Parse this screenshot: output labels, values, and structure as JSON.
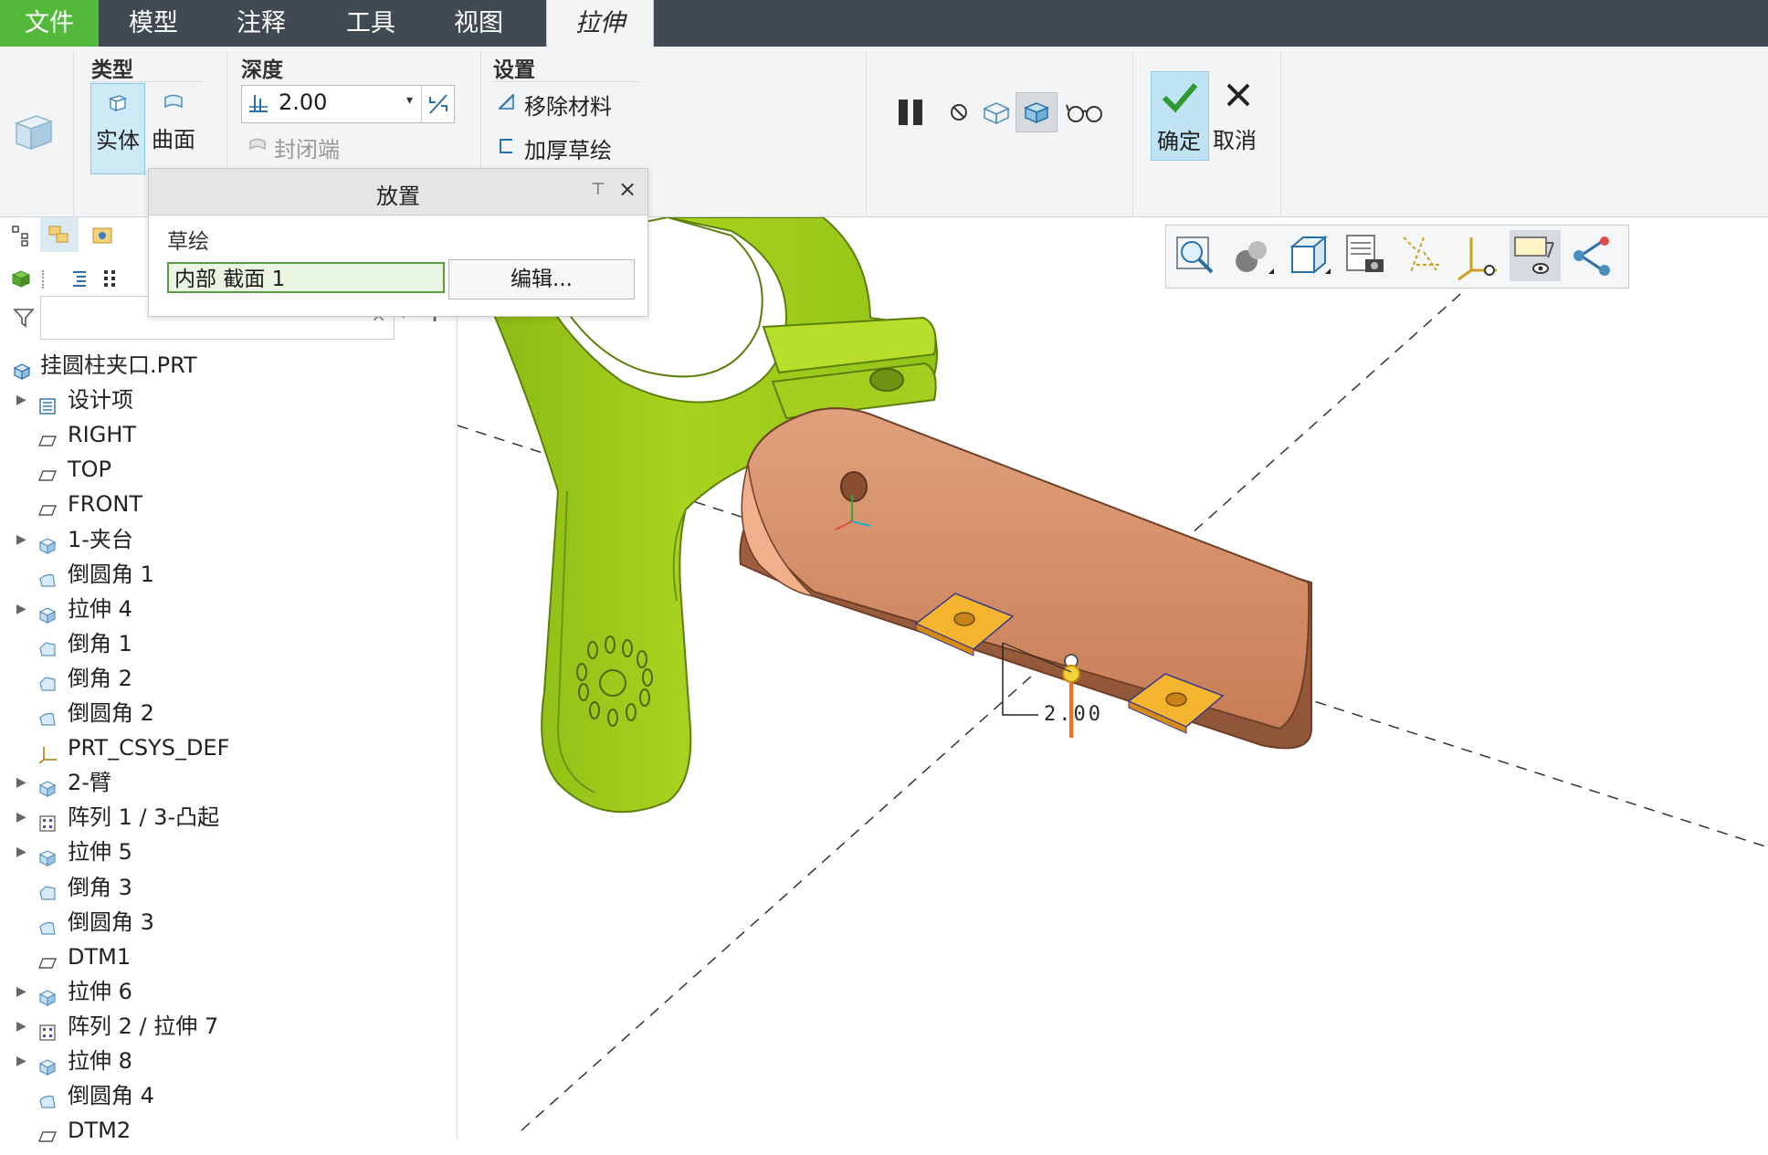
{
  "menubar": {
    "tabs": [
      {
        "label": "文件"
      },
      {
        "label": "模型"
      },
      {
        "label": "注释"
      },
      {
        "label": "工具"
      },
      {
        "label": "视图"
      },
      {
        "label": "拉伸"
      }
    ]
  },
  "ribbon": {
    "type_group": {
      "title": "类型",
      "solid": "实体",
      "surface": "曲面"
    },
    "depth_group": {
      "title": "深度",
      "value": "2.00",
      "capped_ends": "封闭端"
    },
    "settings_group": {
      "title": "设置",
      "remove_material": "移除材料",
      "thicken_sketch": "加厚草绘"
    },
    "confirm": "确定",
    "cancel": "取消"
  },
  "placement_panel": {
    "title": "放置",
    "sketch_label": "草绘",
    "sketch_value": "内部 截面 1",
    "edit_button": "编辑..."
  },
  "model_tree": {
    "filter_placeholder": "",
    "items": [
      {
        "label": "挂圆柱夹口.PRT",
        "icon": "part-icon",
        "expandable": false,
        "root": true
      },
      {
        "label": "设计项",
        "icon": "design-items-icon",
        "expandable": true
      },
      {
        "label": "RIGHT",
        "icon": "datum-plane-icon",
        "expandable": false
      },
      {
        "label": "TOP",
        "icon": "datum-plane-icon",
        "expandable": false
      },
      {
        "label": "FRONT",
        "icon": "datum-plane-icon",
        "expandable": false
      },
      {
        "label": "1-夹台",
        "icon": "extrude-icon",
        "expandable": true
      },
      {
        "label": "倒圆角 1",
        "icon": "round-icon",
        "expandable": false
      },
      {
        "label": "拉伸 4",
        "icon": "extrude-icon",
        "expandable": true
      },
      {
        "label": "倒角 1",
        "icon": "chamfer-icon",
        "expandable": false
      },
      {
        "label": "倒角 2",
        "icon": "chamfer-icon",
        "expandable": false
      },
      {
        "label": "倒圆角 2",
        "icon": "round-icon",
        "expandable": false
      },
      {
        "label": "PRT_CSYS_DEF",
        "icon": "csys-icon",
        "expandable": false
      },
      {
        "label": "2-臂",
        "icon": "extrude-icon",
        "expandable": true
      },
      {
        "label": "阵列 1 / 3-凸起",
        "icon": "pattern-icon",
        "expandable": true
      },
      {
        "label": "拉伸 5",
        "icon": "extrude-icon",
        "expandable": true
      },
      {
        "label": "倒角 3",
        "icon": "chamfer-icon",
        "expandable": false
      },
      {
        "label": "倒圆角 3",
        "icon": "round-icon",
        "expandable": false
      },
      {
        "label": "DTM1",
        "icon": "datum-plane-icon",
        "expandable": false
      },
      {
        "label": "拉伸 6",
        "icon": "extrude-icon",
        "expandable": true
      },
      {
        "label": "阵列 2 / 拉伸 7",
        "icon": "pattern-icon",
        "expandable": true
      },
      {
        "label": "拉伸 8",
        "icon": "extrude-icon",
        "expandable": true
      },
      {
        "label": "倒圆角 4",
        "icon": "round-icon",
        "expandable": false
      },
      {
        "label": "DTM2",
        "icon": "datum-plane-icon",
        "expandable": false
      }
    ]
  },
  "viewport": {
    "dimension": "2.00",
    "colors": {
      "clamp": "#9ac51a",
      "block": "#c9805a",
      "preview": "#f0a020"
    }
  }
}
